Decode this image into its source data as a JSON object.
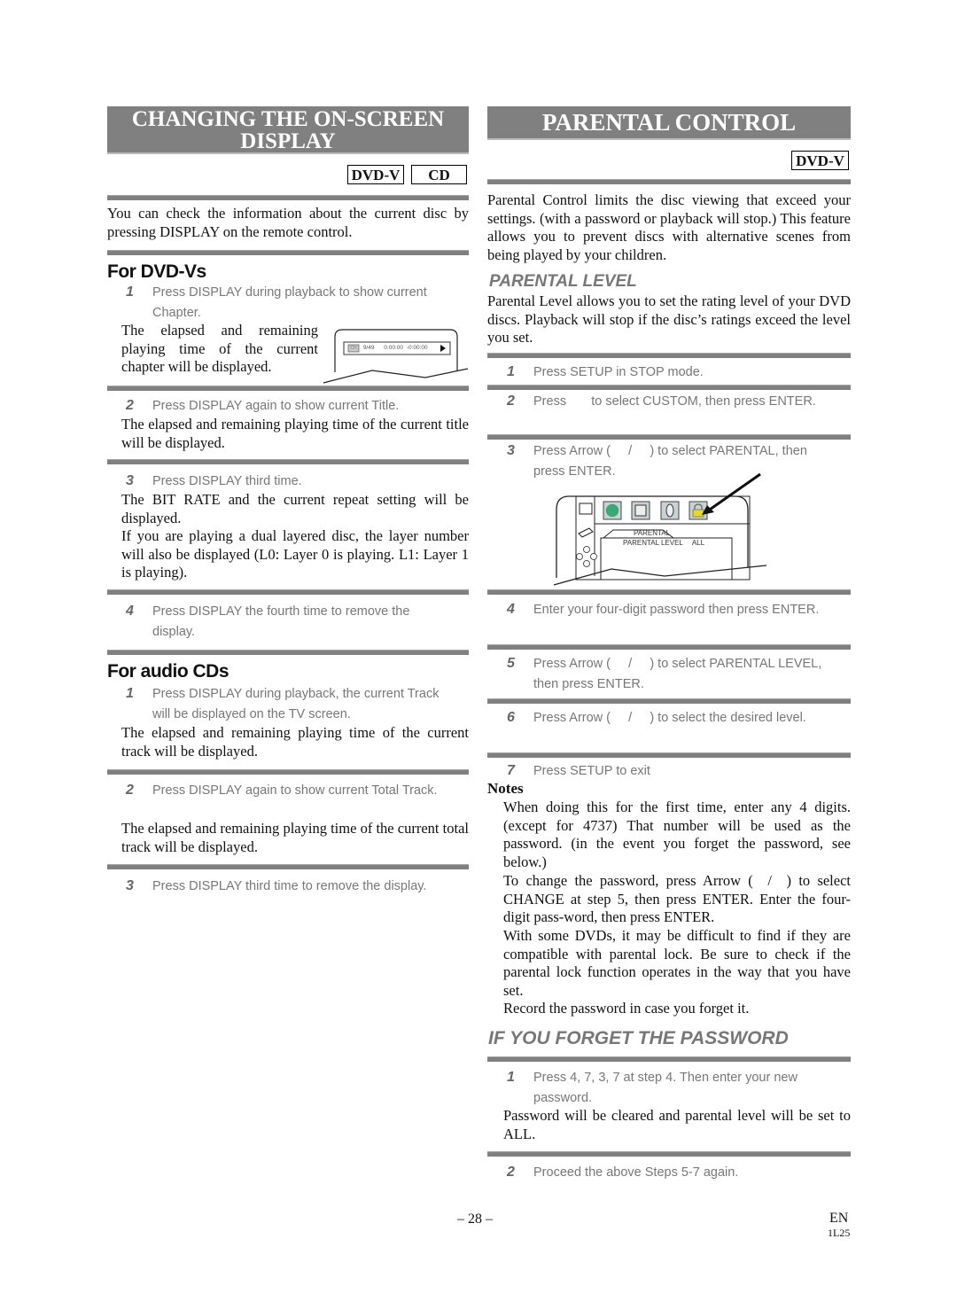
{
  "left": {
    "title_line1": "CHANGING THE ON-SCREEN",
    "title_line2": "DISPLAY",
    "badges": [
      "DVD-V",
      "CD"
    ],
    "intro": "You can check the information about the current disc by pressing DISPLAY on the remote control.",
    "dvd_section": {
      "heading": "For DVD-Vs",
      "steps": [
        {
          "num": "1",
          "text": "Press DISPLAY during playback to show current Chapter.",
          "desc": "The elapsed and remaining playing time of the current chapter will be displayed."
        },
        {
          "num": "2",
          "text": "Press DISPLAY again to show current Title.",
          "desc": "The elapsed and remaining playing time of the current title will be displayed."
        },
        {
          "num": "3",
          "text": "Press DISPLAY third time.",
          "desc": "The BIT RATE and the current repeat setting will be displayed.",
          "desc2": "If you are playing a dual layered disc, the layer number will also be displayed (L0: Layer 0 is playing. L1: Layer 1 is playing)."
        },
        {
          "num": "4",
          "text": "Press DISPLAY the fourth time to remove the display."
        }
      ],
      "osd": {
        "icon_label": "CH",
        "chapter": "9/49",
        "elapsed": "0:00:00",
        "remaining": "-0:00:00"
      }
    },
    "cd_section": {
      "heading": "For audio CDs",
      "steps": [
        {
          "num": "1",
          "text": "Press DISPLAY during playback, the current Track will be displayed on the TV screen.",
          "desc": "The elapsed and remaining playing time of the current track will be displayed."
        },
        {
          "num": "2",
          "text": "Press DISPLAY again to show current Total Track.",
          "desc": "The elapsed and remaining playing time of the current total track will be displayed."
        },
        {
          "num": "3",
          "text": "Press DISPLAY third time to remove the display."
        }
      ]
    }
  },
  "right": {
    "title": "PARENTAL CONTROL",
    "badge": "DVD-V",
    "intro": "Parental Control limits the disc viewing that exceed your settings. (with a password or playback will stop.) This feature allows you to prevent discs with alternative scenes from being played by your children.",
    "level_heading": "PARENTAL LEVEL",
    "level_intro": "Parental Level allows you to set the rating level of your DVD discs. Playback will stop if the disc’s ratings exceed the level you set.",
    "steps": [
      {
        "num": "1",
        "text": "Press SETUP in STOP mode."
      },
      {
        "num": "2",
        "text": "Press       to select CUSTOM, then press ENTER."
      },
      {
        "num": "3",
        "text": "Press Arrow (     /     ) to select PARENTAL, then press ENTER."
      },
      {
        "num": "4",
        "text": "Enter your four-digit password then press ENTER."
      },
      {
        "num": "5",
        "text": "Press Arrow (     /     ) to select PARENTAL LEVEL, then press ENTER."
      },
      {
        "num": "6",
        "text": "Press Arrow (     /     ) to select the desired level."
      },
      {
        "num": "7",
        "text": "Press SETUP to exit"
      }
    ],
    "menu": {
      "tab_label": "PARENTAL",
      "row_label": "PARENTAL LEVEL",
      "row_value": "ALL"
    },
    "notes_heading": "Notes",
    "notes": [
      "When doing this for the first time, enter any 4 digits. (except for 4737) That number will be used as the password. (in the event you forget the password, see below.)",
      "To change the password, press Arrow (  /  ) to select CHANGE at step 5, then press ENTER. Enter the four-digit pass-word, then press ENTER.",
      "With some DVDs, it may be difficult to find if they are compatible with parental lock. Be sure to check if the parental lock function operates in the way that you have set.",
      "Record the password in case you forget it."
    ],
    "forget_heading": "IF YOU FORGET THE PASSWORD",
    "forget_steps": [
      {
        "num": "1",
        "text": "Press 4, 7, 3, 7 at step 4. Then enter your new password.",
        "desc": "Password will be cleared and parental level will be set to ALL."
      },
      {
        "num": "2",
        "text": "Proceed the above Steps 5-7 again."
      }
    ]
  },
  "footer": {
    "page": "– 28 –",
    "lang": "EN",
    "code": "1L25"
  }
}
